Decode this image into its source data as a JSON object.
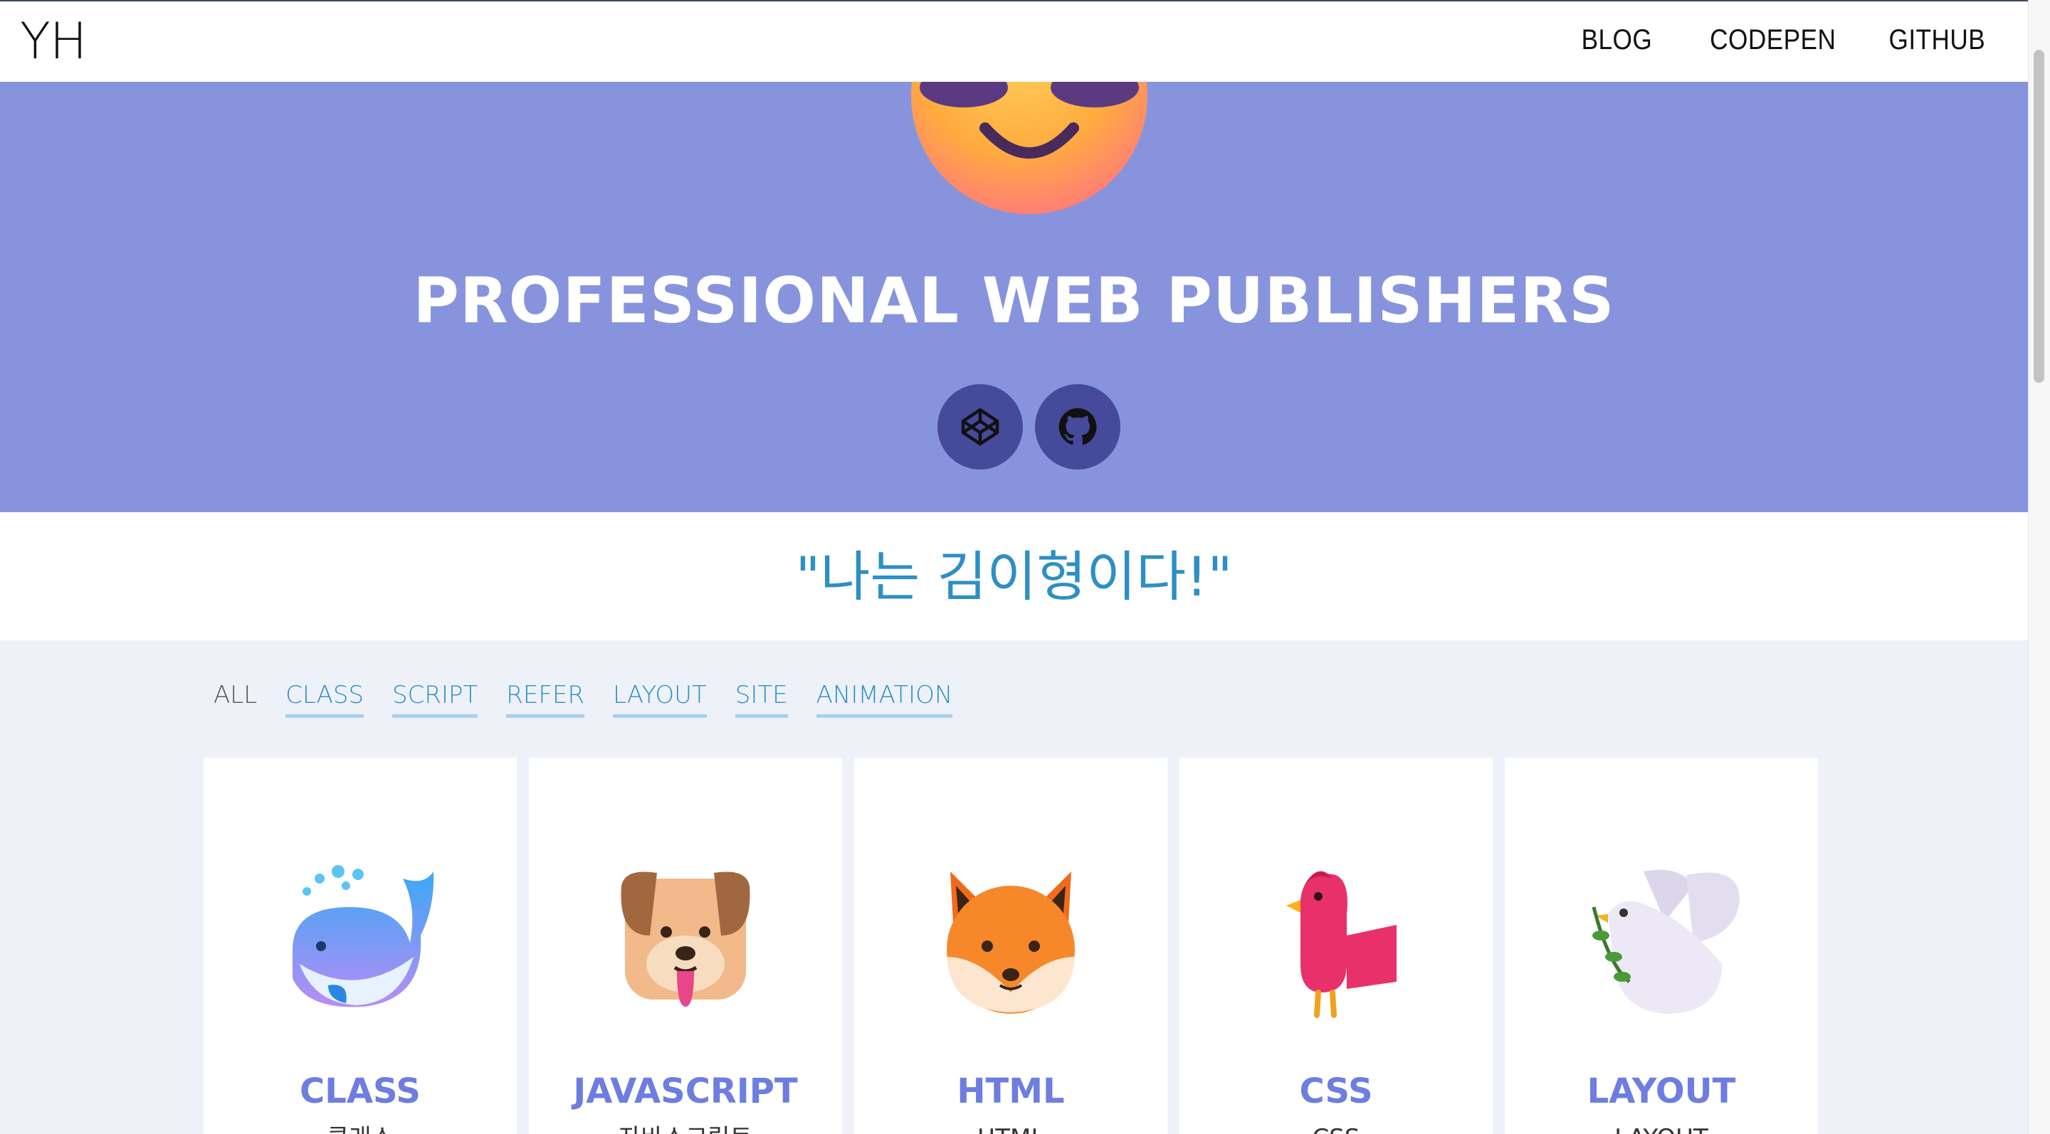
{
  "header": {
    "logo": "YH",
    "nav": [
      "BLOG",
      "CODEPEN",
      "GITHUB"
    ]
  },
  "hero": {
    "title": "PROFESSIONAL WEB PUBLISHERS",
    "background": "#8794dd",
    "socials": [
      {
        "icon": "codepen-icon"
      },
      {
        "icon": "github-icon"
      }
    ]
  },
  "quote": "\"나는 김이형이다!\"",
  "filters": {
    "items": [
      "ALL",
      "CLASS",
      "SCRIPT",
      "REFER",
      "LAYOUT",
      "SITE",
      "ANIMATION"
    ],
    "active": "ALL"
  },
  "cards": [
    {
      "title": "CLASS",
      "subtitle": "클래스",
      "icon": "whale-icon"
    },
    {
      "title": "JAVASCRIPT",
      "subtitle": "자바스크립트",
      "icon": "dog-icon"
    },
    {
      "title": "HTML",
      "subtitle": "HTML",
      "icon": "fox-icon"
    },
    {
      "title": "CSS",
      "subtitle": "CSS",
      "icon": "bird-icon"
    },
    {
      "title": "LAYOUT",
      "subtitle": "LAYOUT",
      "icon": "dove-icon"
    }
  ],
  "colors": {
    "accent": "#2d8fc5",
    "card_title": "#6d7de0",
    "social_bg": "#454a9a",
    "content_bg": "#eef2f8"
  }
}
